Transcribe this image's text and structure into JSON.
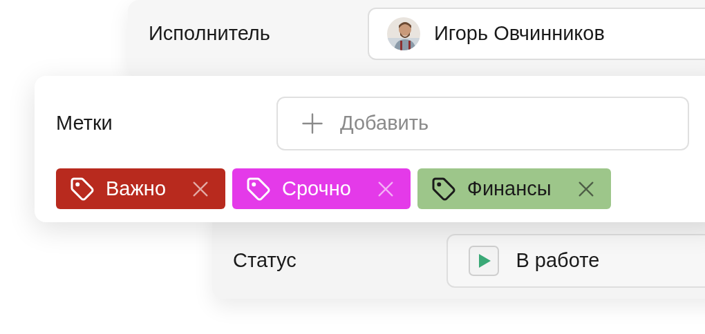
{
  "assignee": {
    "label": "Исполнитель",
    "value": "Игорь Овчинников"
  },
  "tags_card": {
    "label": "Метки",
    "add_button": "Добавить",
    "tags": [
      {
        "label": "Важно",
        "color": "#b82a1e"
      },
      {
        "label": "Срочно",
        "color": "#e43ae9"
      },
      {
        "label": "Финансы",
        "color": "#9dc68a"
      }
    ]
  },
  "status": {
    "label": "Статус",
    "value": "В работе"
  }
}
